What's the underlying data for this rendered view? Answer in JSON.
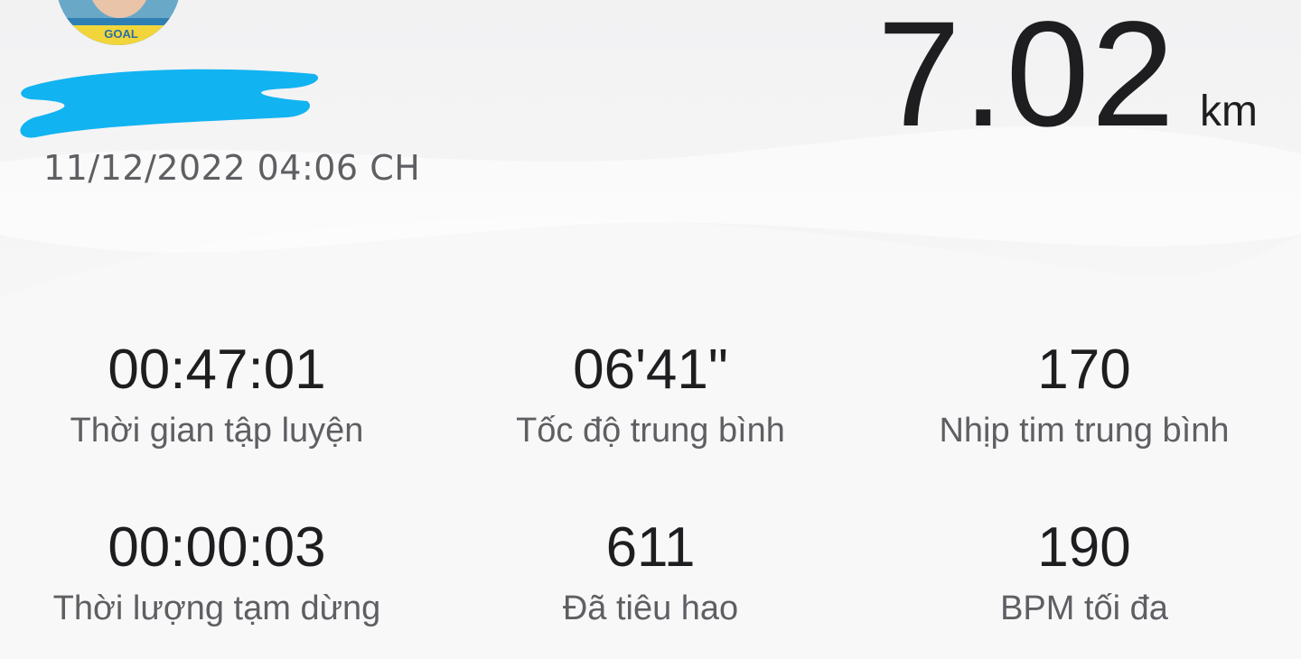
{
  "header": {
    "avatar_icon": "user-avatar-photo",
    "avatar_text": "GOAL",
    "name_redaction_color": "#12b3f1",
    "date": "11/12/2022 04:06 CH"
  },
  "distance": {
    "value": "7.02",
    "unit": "km"
  },
  "stats": [
    {
      "value": "00:47:01",
      "label": "Thời gian tập luyện"
    },
    {
      "value": "06'41\"",
      "label": "Tốc độ trung bình"
    },
    {
      "value": "170",
      "label": "Nhịp tim trung bình"
    },
    {
      "value": "00:00:03",
      "label": "Thời lượng tạm dừng"
    },
    {
      "value": "611",
      "label": "Đã tiêu hao"
    },
    {
      "value": "190",
      "label": "BPM tối đa"
    }
  ]
}
